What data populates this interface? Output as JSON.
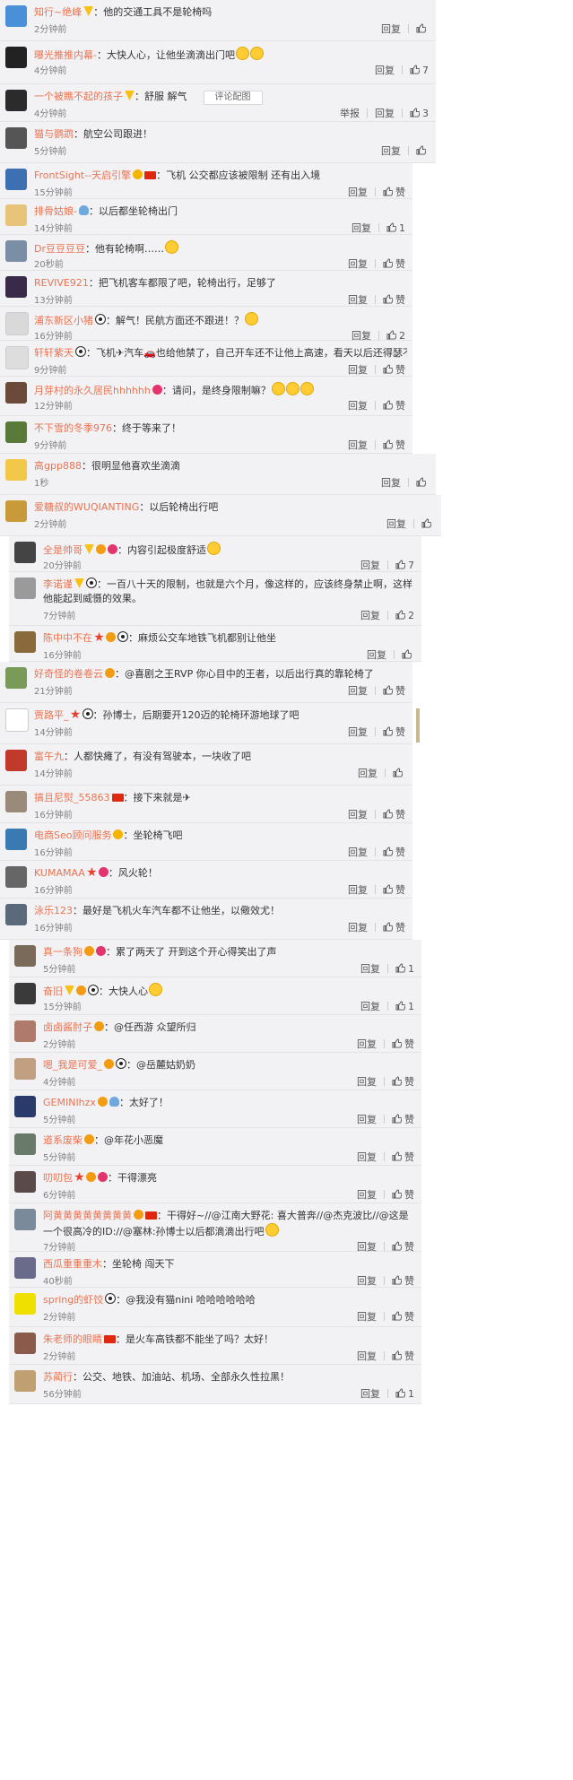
{
  "actions": {
    "reply": "回复",
    "like": "赞",
    "report": "举报"
  },
  "colors": {
    "username": "#eb7350",
    "time": "#808080",
    "card_bg": "#f2f2f5"
  },
  "comments": [
    {
      "user": "知行~绝峰",
      "badges": [
        "v"
      ],
      "content": "他的交通工具不是轮椅吗",
      "time": "2分钟前",
      "likes": "",
      "avatar": "#4a90d9"
    },
    {
      "user": "曝光推推内幕-",
      "badges": [],
      "content": "大快人心，让他坐滴滴出门吧",
      "emojis": 2,
      "time": "4分钟前",
      "likes": "7",
      "avatar": "#222222"
    },
    {
      "user": "一个被瞧不起的孩子",
      "badges": [
        "v"
      ],
      "content": "舒服 解气",
      "tag": "评论配图",
      "report": true,
      "time": "4分钟前",
      "likes": "3",
      "avatar": "#2b2b2b"
    },
    {
      "user": "猫与鹦鹉",
      "badges": [],
      "content": "航空公司跟进！",
      "time": "5分钟前",
      "likes": "",
      "avatar": "#555555"
    },
    {
      "user": "FrontSight--天启引擎",
      "badges": [
        "medal",
        "flag"
      ],
      "content": "飞机  公交都应该被限制    还有出入境",
      "time": "15分钟前",
      "likes": "赞",
      "avatar": "#3d6fb3"
    },
    {
      "user": "排骨姑娘-",
      "badges": [
        "bulb"
      ],
      "content": "以后都坐轮椅出门",
      "time": "14分钟前",
      "likes": "1",
      "avatar": "#e8c37a"
    },
    {
      "user": "Dr豆豆豆豆",
      "badges": [],
      "content": "他有轮椅啊……",
      "emojis": 1,
      "time": "20秒前",
      "likes": "赞",
      "avatar": "#7a8ea6"
    },
    {
      "user": "REVIVE921",
      "badges": [],
      "content": "把飞机客车都限了吧，轮椅出行，足够了",
      "time": "13分钟前",
      "likes": "赞",
      "avatar": "#3a2a4a"
    },
    {
      "user": "浦东新区小猪",
      "badges": [
        "panda"
      ],
      "content": "解气！民航方面还不跟进！？",
      "emojis": 1,
      "time": "16分钟前",
      "likes": "2",
      "avatar": "#d9d9d9"
    },
    {
      "user": "轩轩紫天",
      "badges": [
        "panda"
      ],
      "content": "飞机✈汽车🚗也给他禁了，自己开车还不让他上高速，看天以后还得瑟不？",
      "time": "9分钟前",
      "likes": "赞",
      "avatar": "#dddddd"
    },
    {
      "user": "月芽村的永久居民hhhhhh",
      "badges": [
        "heart"
      ],
      "content": "请问，是终身限制嘛？",
      "emojis": 3,
      "time": "12分钟前",
      "likes": "赞",
      "avatar": "#6b4a3a"
    },
    {
      "user": "不下雪的冬季976",
      "badges": [],
      "content": "终于等来了！",
      "time": "9分钟前",
      "likes": "赞",
      "avatar": "#5a7a3a"
    },
    {
      "user": "高gpp888",
      "badges": [],
      "content": "很明显他喜欢坐滴滴",
      "time": "1秒",
      "likes": "",
      "avatar": "#f2c84b"
    },
    {
      "user": "爱糖叔的WUQIANTING",
      "badges": [],
      "content": "以后轮椅出行吧",
      "time": "2分钟前",
      "likes": "",
      "avatar": "#c89a3a"
    },
    {
      "user": "全是帅哥",
      "badges": [
        "v",
        "vip",
        "heart"
      ],
      "content": "内容引起极度舒适",
      "emojis": 1,
      "time": "20分钟前",
      "likes": "7",
      "avatar": "#444444"
    },
    {
      "user": "李诺谨",
      "badges": [
        "v",
        "panda"
      ],
      "content": "一百八十天的限制，也就是六个月，像这样的，应该终身禁止啊，这样他能起到威慑的效果。",
      "time": "7分钟前",
      "likes": "2",
      "avatar": "#9a9a9a"
    },
    {
      "user": "陈中中不在",
      "badges": [
        "star",
        "vip",
        "panda"
      ],
      "content": "麻烦公交车地铁飞机都别让他坐",
      "time": "16分钟前",
      "likes": "",
      "avatar": "#8a6a3a"
    },
    {
      "user": "好奇怪的卷卷云",
      "badges": [
        "vip"
      ],
      "content": "@喜剧之王RVP 你心目中的王者，以后出行真的靠轮椅了",
      "time": "21分钟前",
      "likes": "赞",
      "avatar": "#7a9a5a"
    },
    {
      "user": "贾路平_",
      "badges": [
        "star",
        "panda"
      ],
      "content": "孙博士，后期要开120迈的轮椅环游地球了吧",
      "time": "14分钟前",
      "likes": "赞",
      "avatar": "#ffffff"
    },
    {
      "user": "富午九",
      "badges": [],
      "content": "人都快瘫了，有没有驾驶本，一块收了吧",
      "time": "14分钟前",
      "likes": "",
      "avatar": "#c0392b"
    },
    {
      "user": "搞且尼熨_55863",
      "badges": [
        "flag"
      ],
      "content": "接下来就是✈",
      "time": "16分钟前",
      "likes": "赞",
      "avatar": "#9a8a7a"
    },
    {
      "user": "电商Seo顾问服务",
      "badges": [
        "medal"
      ],
      "content": "坐轮椅飞吧",
      "time": "16分钟前",
      "likes": "赞",
      "avatar": "#3a7ab3"
    },
    {
      "user": "KUMAMAA",
      "badges": [
        "star",
        "heart"
      ],
      "content": "风火轮！",
      "time": "16分钟前",
      "likes": "赞",
      "avatar": "#666666"
    },
    {
      "user": "泳乐123",
      "badges": [],
      "content": "最好是飞机火车汽车都不让他坐，以儆效尤！",
      "time": "16分钟前",
      "likes": "赞",
      "avatar": "#5a6a7a"
    },
    {
      "user": "真一条狗",
      "badges": [
        "vip",
        "heart"
      ],
      "content": "累了两天了 开到这个开心得笑出了声",
      "time": "5分钟前",
      "likes": "1",
      "avatar": "#7a6a5a"
    },
    {
      "user": "奋旧",
      "badges": [
        "v",
        "vip",
        "panda"
      ],
      "content": "大快人心",
      "emojis": 1,
      "time": "15分钟前",
      "likes": "1",
      "avatar": "#3a3a3a"
    },
    {
      "user": "卤卤酱肘子",
      "badges": [
        "vip"
      ],
      "content": "@任西游 众望所归",
      "time": "2分钟前",
      "likes": "赞",
      "avatar": "#b07a6a"
    },
    {
      "user": "嗯_我是可爱_",
      "badges": [
        "vip",
        "panda"
      ],
      "content": "@岳麓姑奶奶",
      "time": "4分钟前",
      "likes": "赞",
      "avatar": "#c0a080"
    },
    {
      "user": "GEMINIhzx",
      "badges": [
        "vip",
        "bulb"
      ],
      "content": "太好了！",
      "time": "5分钟前",
      "likes": "赞",
      "avatar": "#2a3a6a"
    },
    {
      "user": "道系废柴",
      "badges": [
        "vip"
      ],
      "content": "@年花小恶魔",
      "time": "5分钟前",
      "likes": "赞",
      "avatar": "#6a7a6a"
    },
    {
      "user": "叨叨包",
      "badges": [
        "star",
        "vip",
        "heart"
      ],
      "content": "干得漂亮",
      "time": "6分钟前",
      "likes": "赞",
      "avatar": "#5a4a4a"
    },
    {
      "user": "阿黄黄黄黄黄黄黄黄",
      "badges": [
        "vip",
        "flag"
      ],
      "content": "干得好~//@江南大野花: 喜大普奔//@杰克波比//@这是一个很高冷的ID://@塞林:孙博士以后都滴滴出行吧",
      "emojis": 1,
      "time": "7分钟前",
      "likes": "赞",
      "avatar": "#7a8a9a"
    },
    {
      "user": "西瓜重重重木",
      "badges": [],
      "content": "坐轮椅 闯天下",
      "time": "40秒前",
      "likes": "赞",
      "avatar": "#6a6a8a"
    },
    {
      "user": "spring的虾饺",
      "badges": [
        "panda"
      ],
      "content": "@我没有猫nini 哈哈哈哈哈哈",
      "time": "2分钟前",
      "likes": "赞",
      "avatar": "#f0e000"
    },
    {
      "user": "朱老师的眼睛",
      "badges": [
        "flag"
      ],
      "content": "是火车高铁都不能坐了吗？太好！",
      "time": "2分钟前",
      "likes": "赞",
      "avatar": "#8a5a4a"
    },
    {
      "user": "苏蔺行",
      "badges": [],
      "content": "公交、地铁、加油站、机场、全部永久性拉黑！",
      "time": "56分钟前",
      "likes": "1",
      "avatar": "#c0a070"
    }
  ]
}
